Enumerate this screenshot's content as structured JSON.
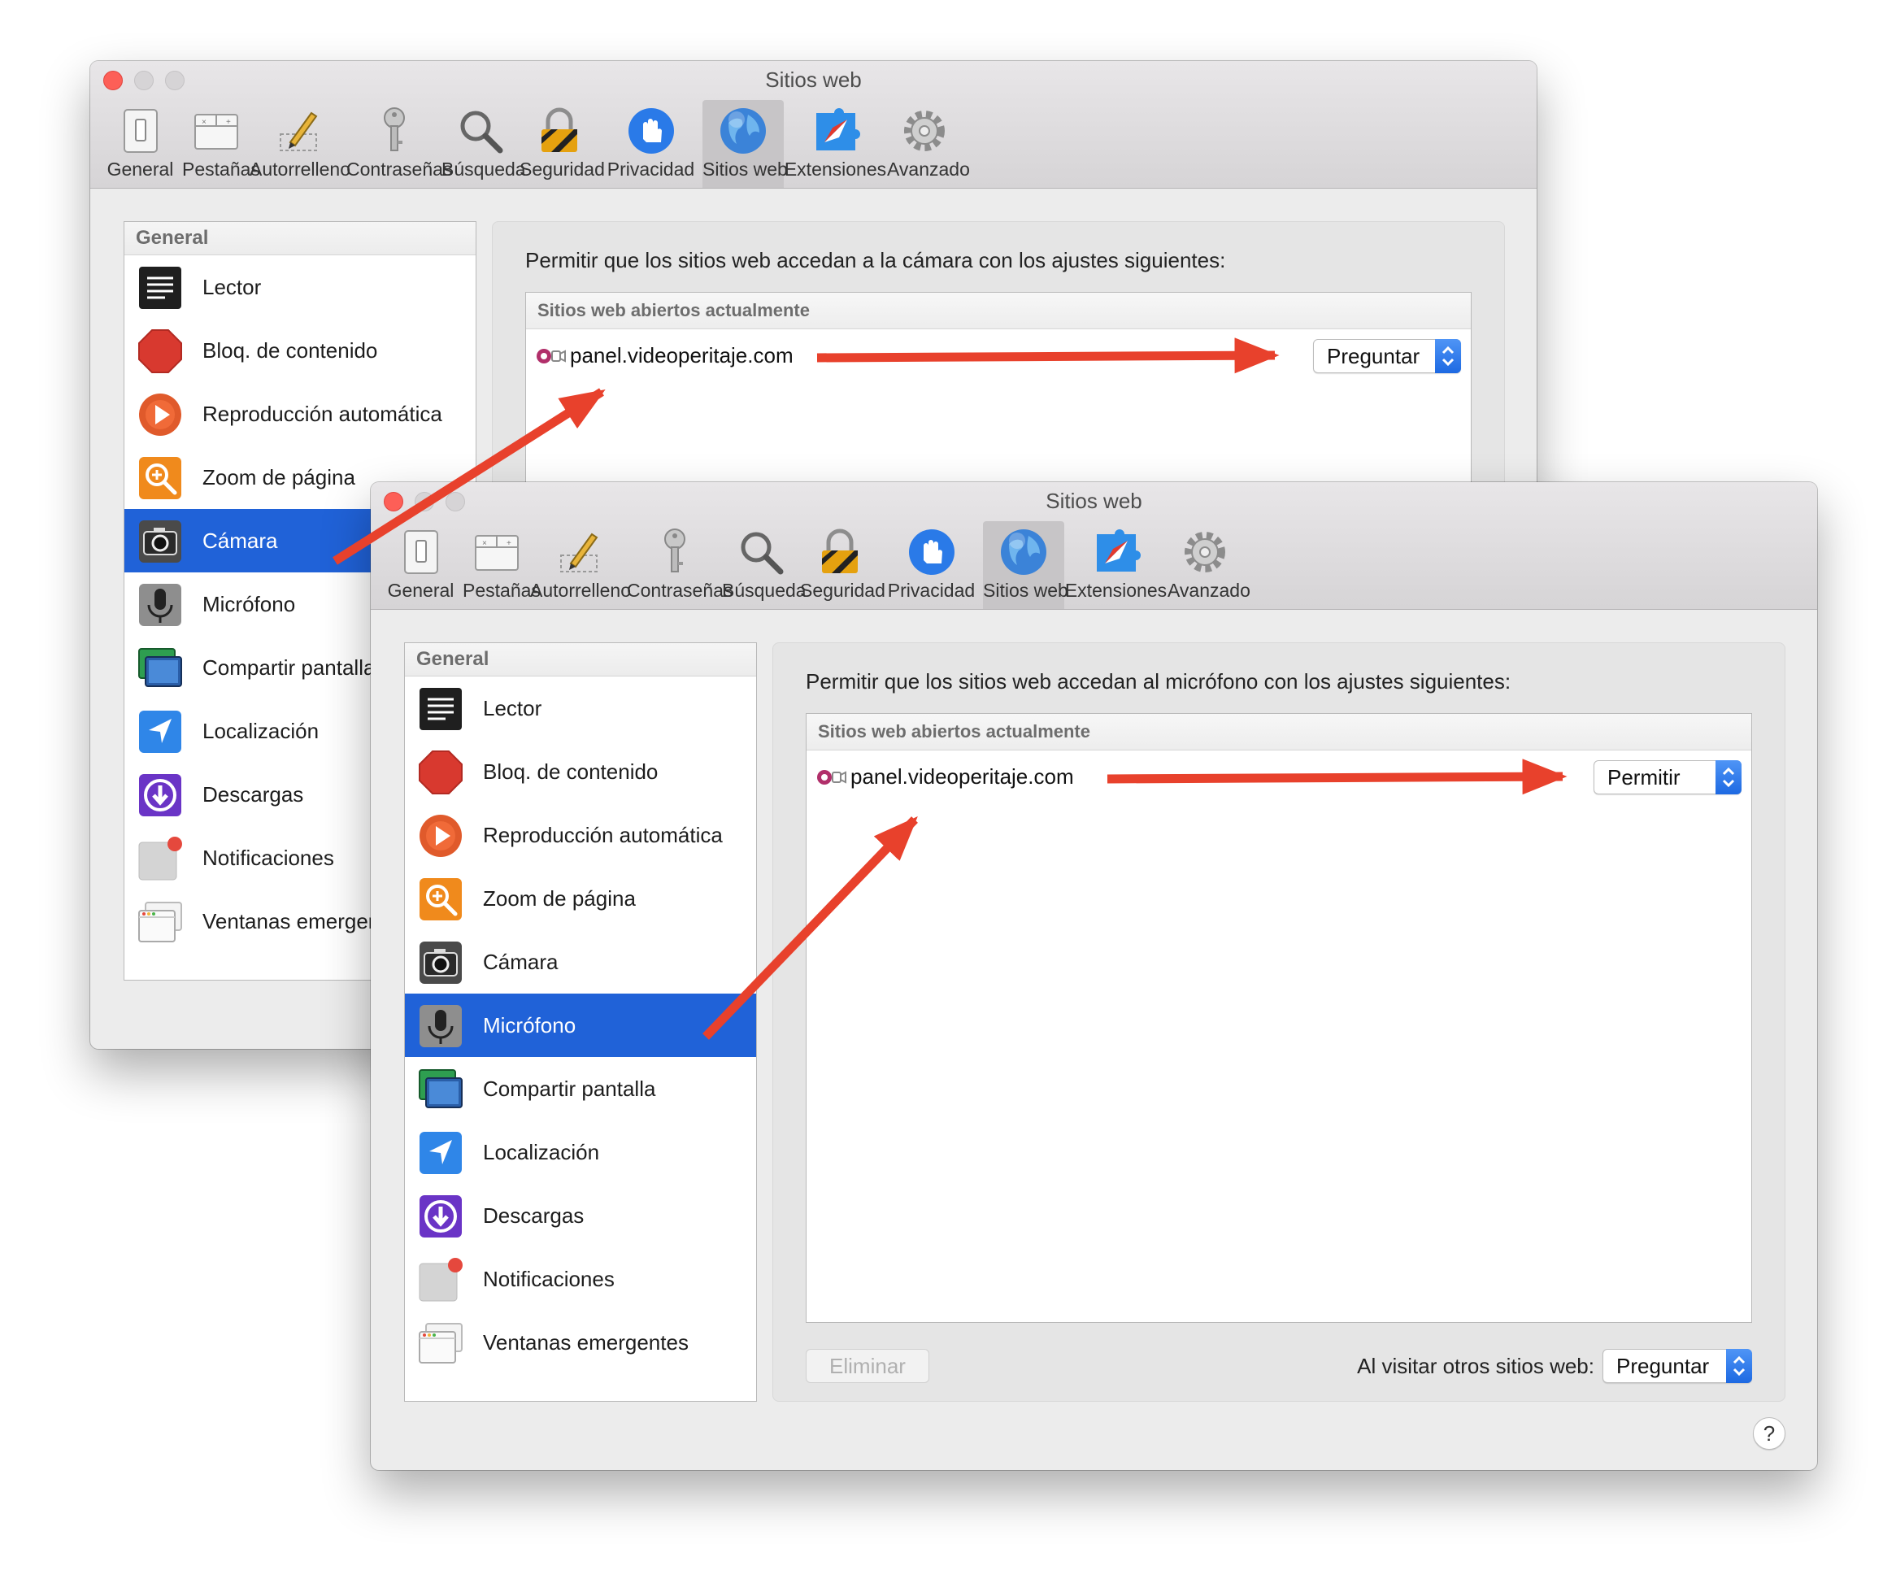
{
  "colors": {
    "arrow": "#e8412c",
    "selection": "#2062d8",
    "close": "#fd5f57"
  },
  "back_window": {
    "title": "Sitios web",
    "toolbar": [
      {
        "label": "General",
        "icon": "general-switch-icon"
      },
      {
        "label": "Pestañas",
        "icon": "tabs-icon"
      },
      {
        "label": "Autorrelleno",
        "icon": "pencil-icon"
      },
      {
        "label": "Contraseñas",
        "icon": "key-icon"
      },
      {
        "label": "Búsqueda",
        "icon": "magnifier-icon"
      },
      {
        "label": "Seguridad",
        "icon": "lock-icon"
      },
      {
        "label": "Privacidad",
        "icon": "hand-icon"
      },
      {
        "label": "Sitios web",
        "icon": "globe-icon",
        "selected": true
      },
      {
        "label": "Extensiones",
        "icon": "puzzle-compass-icon"
      },
      {
        "label": "Avanzado",
        "icon": "gear-icon"
      }
    ],
    "sidebar": {
      "header": "General",
      "items": [
        {
          "label": "Lector",
          "icon": "reader-icon"
        },
        {
          "label": "Bloq. de contenido",
          "icon": "stop-sign-icon"
        },
        {
          "label": "Reproducción automática",
          "icon": "play-icon"
        },
        {
          "label": "Zoom de página",
          "icon": "zoom-icon"
        },
        {
          "label": "Cámara",
          "icon": "camera-icon",
          "selected": true
        },
        {
          "label": "Micrófono",
          "icon": "microphone-icon"
        },
        {
          "label": "Compartir pantalla",
          "icon": "screen-share-icon"
        },
        {
          "label": "Localización",
          "icon": "location-arrow-icon"
        },
        {
          "label": "Descargas",
          "icon": "download-icon"
        },
        {
          "label": "Notificaciones",
          "icon": "notification-icon"
        },
        {
          "label": "Ventanas emergentes",
          "icon": "popup-window-icon"
        }
      ]
    },
    "prompt": "Permitir que los sitios web accedan a la cámara con los ajustes siguientes:",
    "table_header": "Sitios web abiertos actualmente",
    "site": "panel.videoperitaje.com",
    "site_setting": "Preguntar"
  },
  "front_window": {
    "title": "Sitios web",
    "toolbar": [
      {
        "label": "General",
        "icon": "general-switch-icon"
      },
      {
        "label": "Pestañas",
        "icon": "tabs-icon"
      },
      {
        "label": "Autorrelleno",
        "icon": "pencil-icon"
      },
      {
        "label": "Contraseñas",
        "icon": "key-icon"
      },
      {
        "label": "Búsqueda",
        "icon": "magnifier-icon"
      },
      {
        "label": "Seguridad",
        "icon": "lock-icon"
      },
      {
        "label": "Privacidad",
        "icon": "hand-icon"
      },
      {
        "label": "Sitios web",
        "icon": "globe-icon",
        "selected": true
      },
      {
        "label": "Extensiones",
        "icon": "puzzle-compass-icon"
      },
      {
        "label": "Avanzado",
        "icon": "gear-icon"
      }
    ],
    "sidebar": {
      "header": "General",
      "items": [
        {
          "label": "Lector",
          "icon": "reader-icon"
        },
        {
          "label": "Bloq. de contenido",
          "icon": "stop-sign-icon"
        },
        {
          "label": "Reproducción automática",
          "icon": "play-icon"
        },
        {
          "label": "Zoom de página",
          "icon": "zoom-icon"
        },
        {
          "label": "Cámara",
          "icon": "camera-icon"
        },
        {
          "label": "Micrófono",
          "icon": "microphone-icon",
          "selected": true
        },
        {
          "label": "Compartir pantalla",
          "icon": "screen-share-icon"
        },
        {
          "label": "Localización",
          "icon": "location-arrow-icon"
        },
        {
          "label": "Descargas",
          "icon": "download-icon"
        },
        {
          "label": "Notificaciones",
          "icon": "notification-icon"
        },
        {
          "label": "Ventanas emergentes",
          "icon": "popup-window-icon"
        }
      ]
    },
    "prompt": "Permitir que los sitios web accedan al micrófono con los ajustes siguientes:",
    "table_header": "Sitios web abiertos actualmente",
    "site": "panel.videoperitaje.com",
    "site_setting": "Permitir",
    "remove_button": "Eliminar",
    "other_sites_label": "Al visitar otros sitios web:",
    "other_sites_setting": "Preguntar",
    "help": "?"
  }
}
